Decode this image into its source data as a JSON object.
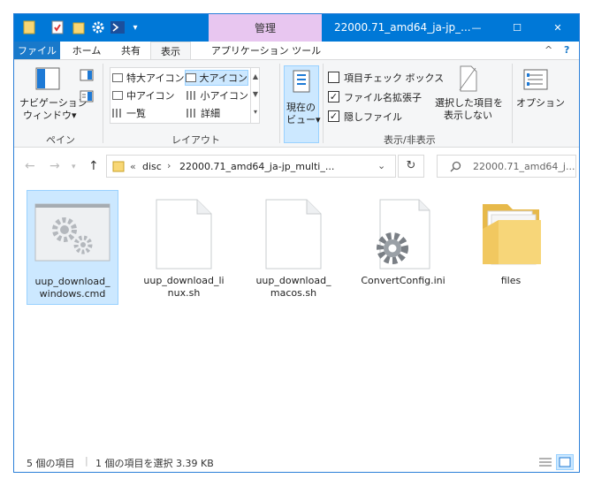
{
  "titlebar": {
    "context_tab": "管理",
    "title": "22000.71_amd64_ja-jp_...",
    "minimize_glyph": "—",
    "maximize_glyph": "☐",
    "close_glyph": "✕",
    "accent": "#0078d7"
  },
  "tabs": {
    "file": "ファイル",
    "home": "ホーム",
    "share": "共有",
    "view": "表示",
    "app_tools": "アプリケーション ツール",
    "collapse_glyph": "^",
    "help_glyph": "?"
  },
  "ribbon": {
    "pane": {
      "nav_pane": "ナビゲーション",
      "nav_pane2": "ウィンドウ▾",
      "label": "ペイン"
    },
    "layout": {
      "items": [
        "特大アイコン",
        "大アイコン",
        "中アイコン",
        "小アイコン",
        "一覧",
        "詳細"
      ],
      "selected": "大アイコン",
      "label": "レイアウト"
    },
    "view_group": {
      "current_view": "現在の",
      "current_view2": "ビュー▾"
    },
    "showhide": {
      "item_checkbox": "項目チェック ボックス",
      "extensions": "ファイル名拡張子",
      "hidden": "隠しファイル",
      "item_checkbox_checked": false,
      "extensions_checked": true,
      "hidden_checked": true,
      "hide_selected": "選択した項目を",
      "hide_selected2": "表示しない",
      "label": "表示/非表示"
    },
    "options": "オプション"
  },
  "address": {
    "prefix": "«",
    "crumb1": "disc",
    "sep": "›",
    "crumb2": "22000.71_amd64_ja-jp_multi_...",
    "search_placeholder": "22000.71_amd64_j..."
  },
  "files": [
    {
      "name": "uup_download_windows.cmd",
      "line1": "uup_download_",
      "line2": "windows.cmd",
      "selected": true
    },
    {
      "name": "uup_download_linux.sh",
      "line1": "uup_download_li",
      "line2": "nux.sh",
      "selected": false
    },
    {
      "name": "uup_download_macos.sh",
      "line1": "uup_download_",
      "line2": "macos.sh",
      "selected": false
    },
    {
      "name": "ConvertConfig.ini",
      "line1": "ConvertConfig.ini",
      "line2": "",
      "selected": false
    },
    {
      "name": "files",
      "line1": "files",
      "line2": "",
      "selected": false
    }
  ],
  "status": {
    "count": "5 個の項目",
    "selection": "1 個の項目を選択  3.39 KB"
  }
}
